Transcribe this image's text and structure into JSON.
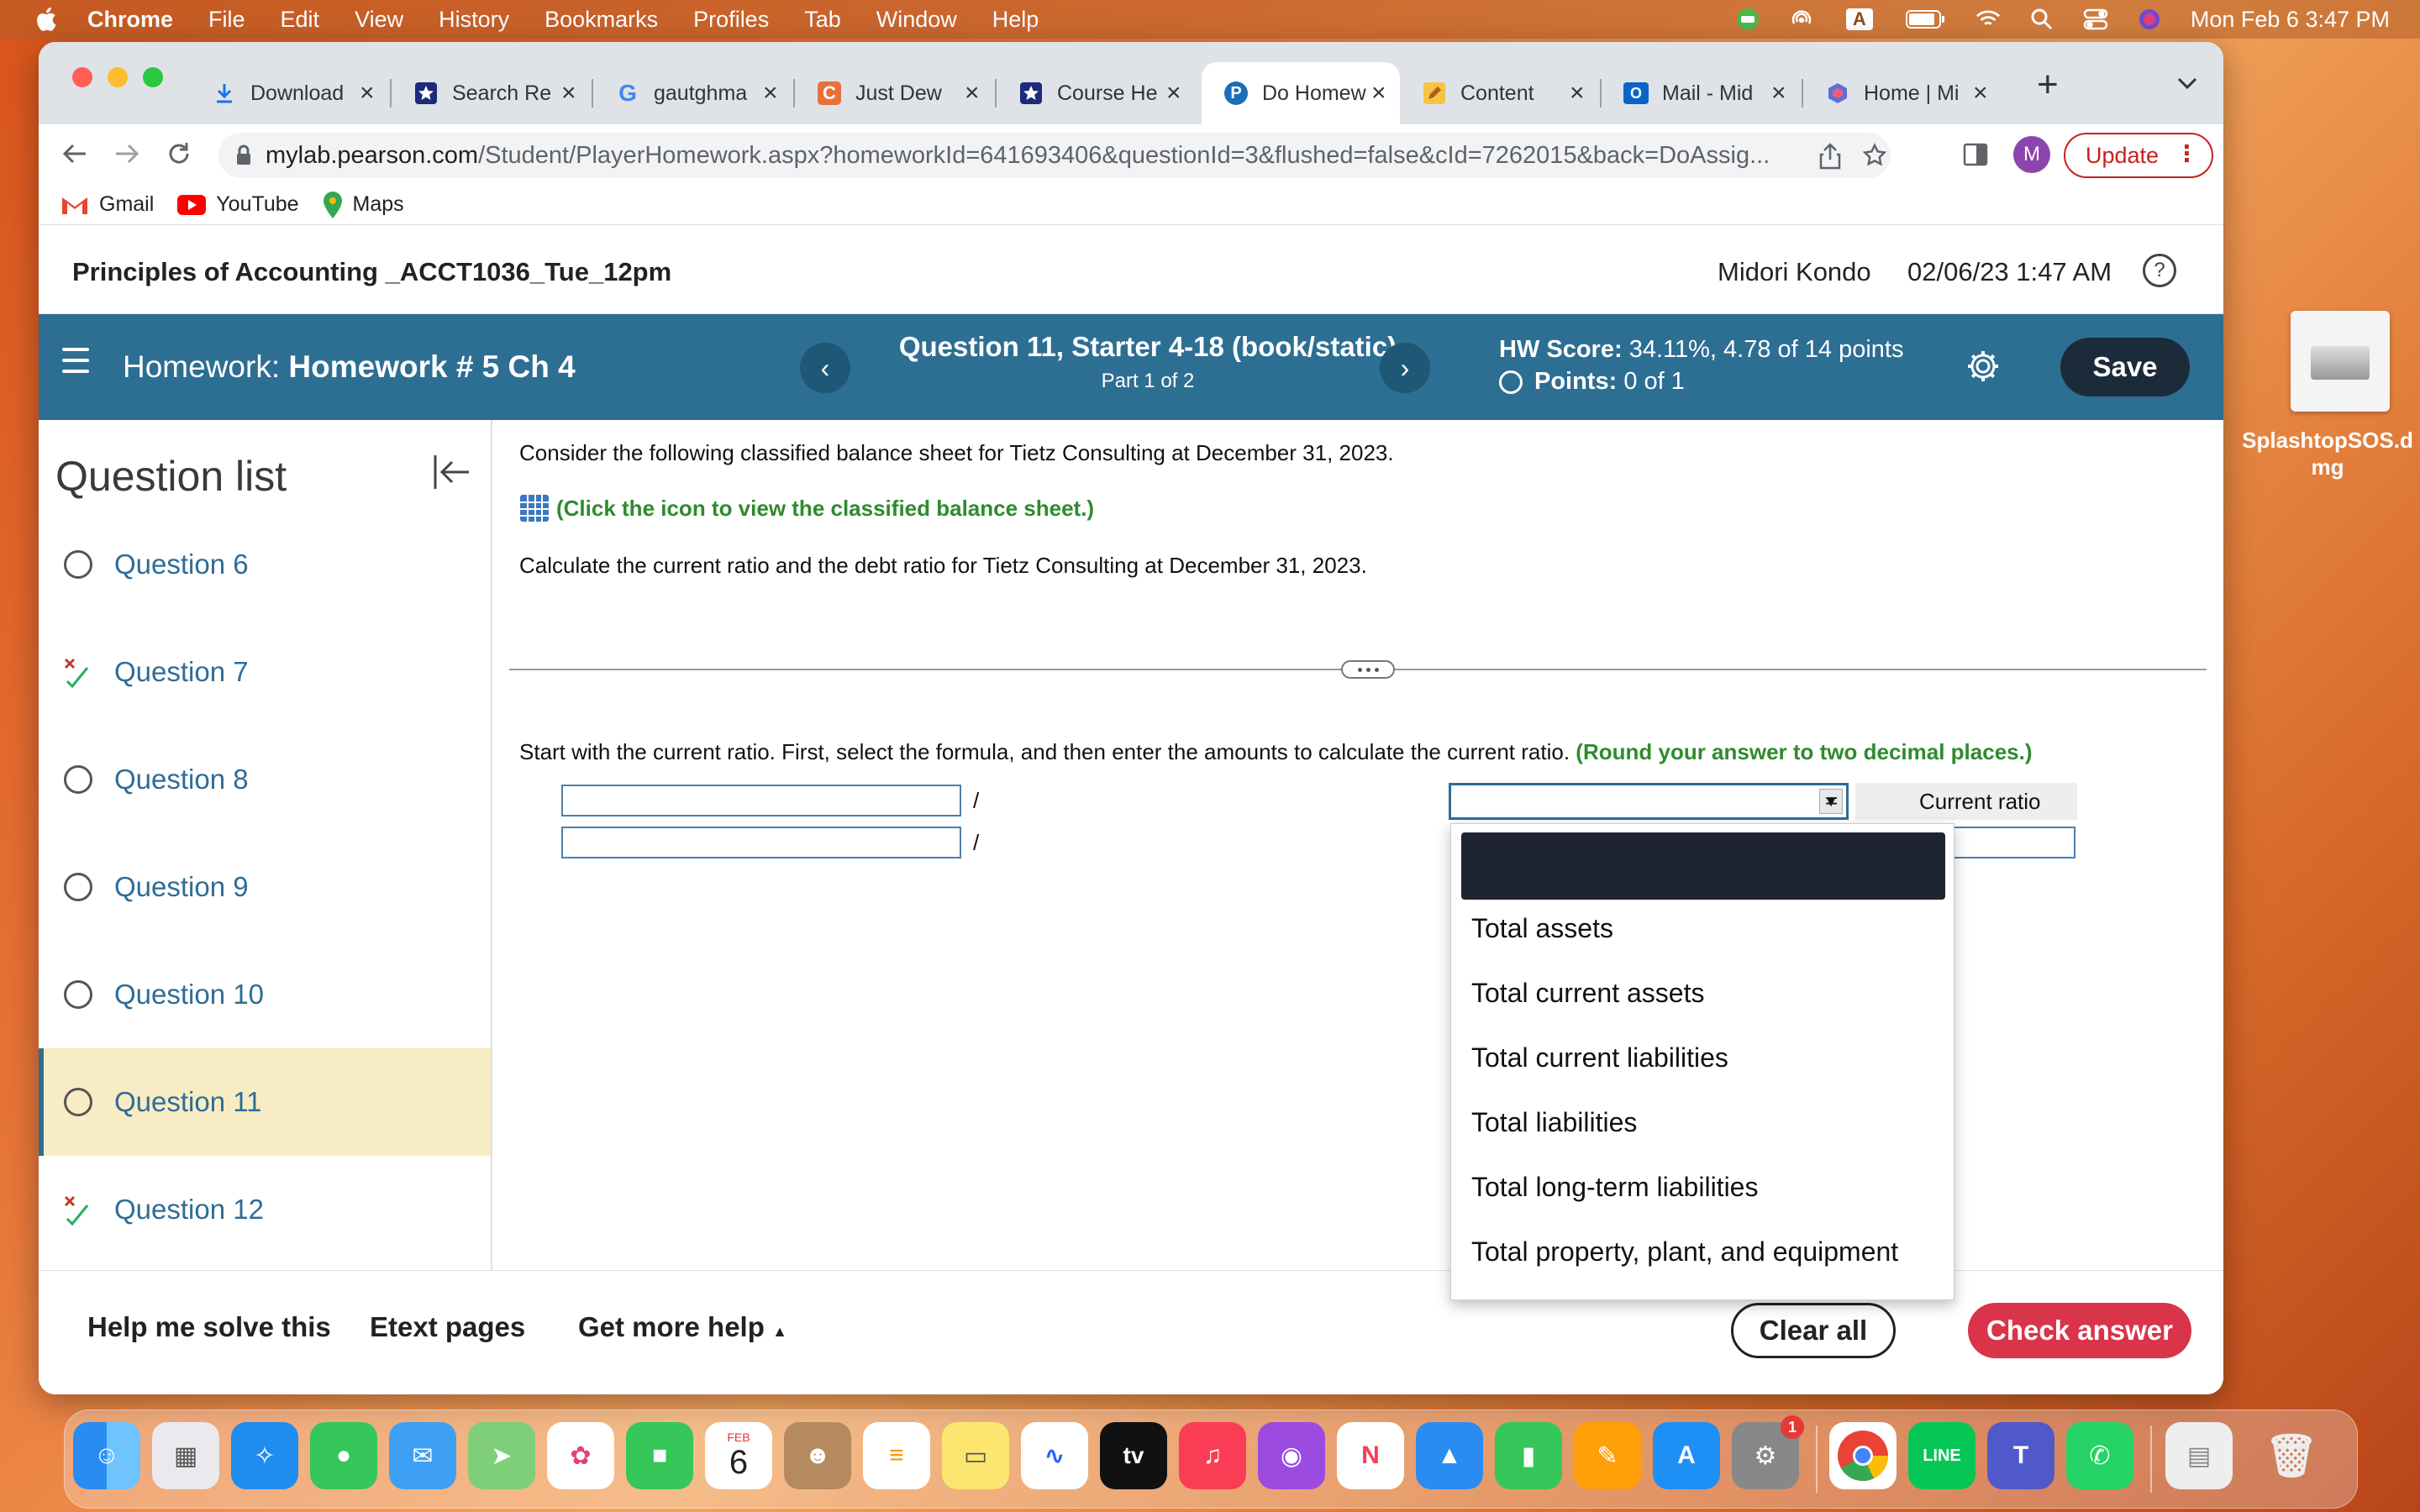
{
  "menubar": {
    "app": "Chrome",
    "items": [
      "File",
      "Edit",
      "View",
      "History",
      "Bookmarks",
      "Profiles",
      "Tab",
      "Window",
      "Help"
    ],
    "datetime": "Mon Feb 6  3:47 PM",
    "input_source": "A"
  },
  "tabs": [
    {
      "title": "Download",
      "icon": "download-icon"
    },
    {
      "title": "Search Re",
      "icon": "star-shield-icon"
    },
    {
      "title": "gautghma",
      "icon": "google-icon"
    },
    {
      "title": "Just Dew",
      "icon": "c-logo-icon"
    },
    {
      "title": "Course He",
      "icon": "star-shield-icon"
    },
    {
      "title": "Do Homew",
      "icon": "pearson-icon",
      "active": true
    },
    {
      "title": "Content",
      "icon": "pencil-icon"
    },
    {
      "title": "Mail - Mid",
      "icon": "outlook-icon"
    },
    {
      "title": "Home | Mi",
      "icon": "office-icon"
    }
  ],
  "address": {
    "host": "mylab.pearson.com",
    "path": "/Student/PlayerHomework.aspx?homeworkId=641693406&questionId=3&flushed=false&cId=7262015&back=DoAssig...",
    "avatar_letter": "M",
    "update_label": "Update"
  },
  "bookmarks": [
    "Gmail",
    "YouTube",
    "Maps"
  ],
  "course": {
    "title": "Principles of Accounting _ACCT1036_Tue_12pm",
    "user": "Midori Kondo",
    "datetime": "02/06/23 1:47 AM"
  },
  "homework": {
    "label": "Homework:",
    "name": "Homework # 5 Ch 4",
    "question_title": "Question 11, Starter 4-18 (book/static)",
    "question_sub": "Part 1 of 2",
    "score_label": "HW Score:",
    "score_value": "34.11%, 4.78 of 14 points",
    "points_label": "Points:",
    "points_value": "0 of 1",
    "save_label": "Save"
  },
  "question_list": {
    "heading": "Question list",
    "items": [
      {
        "label": "Question 6",
        "status": "unanswered"
      },
      {
        "label": "Question 7",
        "status": "partial"
      },
      {
        "label": "Question 8",
        "status": "unanswered"
      },
      {
        "label": "Question 9",
        "status": "unanswered"
      },
      {
        "label": "Question 10",
        "status": "unanswered"
      },
      {
        "label": "Question 11",
        "status": "current"
      },
      {
        "label": "Question 12",
        "status": "partial"
      }
    ]
  },
  "question": {
    "intro": "Consider the following classified balance sheet for Tietz Consulting at December 31, 2023.",
    "icon_link": "(Click the icon to view the classified balance sheet.)",
    "task": "Calculate the current ratio and the debt ratio for Tietz Consulting at December 31, 2023.",
    "instruction": "Start with the current ratio. First, select the formula, and then enter the amounts to calculate the current ratio.",
    "round_note": "(Round your answer to two decimal places.)",
    "slash": "/",
    "equals": "=",
    "result_label": "Current ratio"
  },
  "dropdown": {
    "options": [
      "Total assets",
      "Total current assets",
      "Total current liabilities",
      "Total liabilities",
      "Total long-term liabilities",
      "Total property, plant, and equipment"
    ]
  },
  "footer": {
    "help_solve": "Help me solve this",
    "etext": "Etext pages",
    "more_help": "Get more help",
    "clear_all": "Clear all",
    "check_answer": "Check answer"
  },
  "desktop": {
    "file_label": "SplashtopSOS.dmg"
  },
  "dock": {
    "calendar_month": "FEB",
    "calendar_day": "6",
    "tv_label": "tv",
    "settings_badge": "1",
    "line_label": "LINE"
  }
}
